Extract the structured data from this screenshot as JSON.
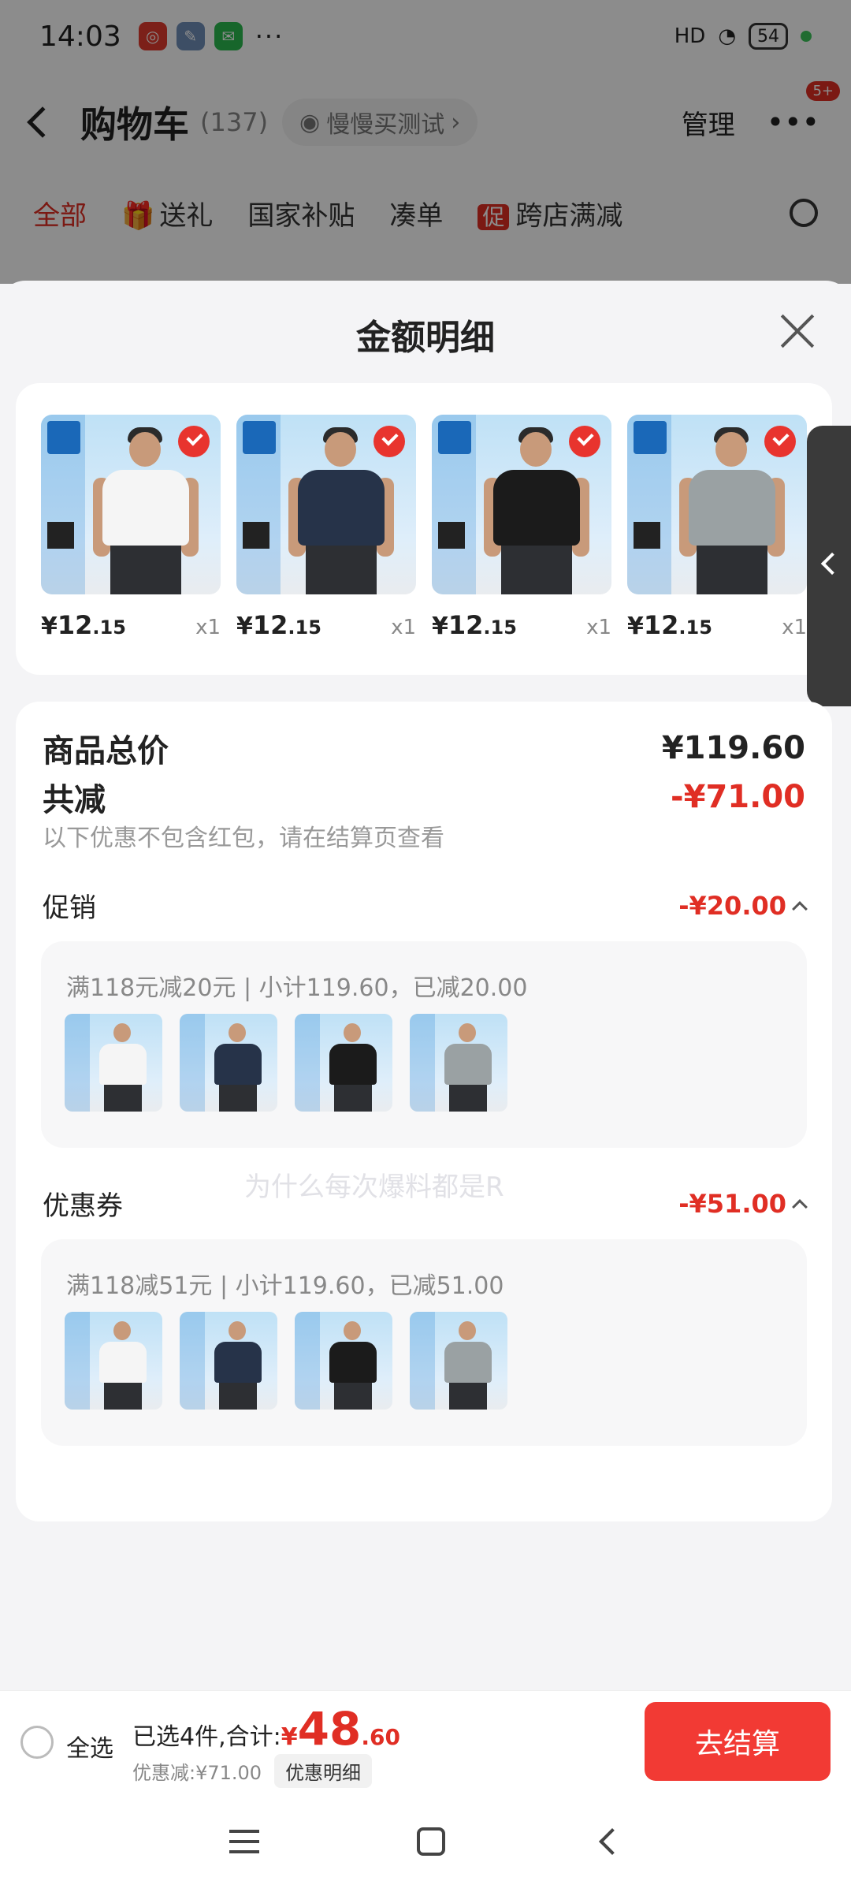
{
  "status_bar": {
    "time": "14:03",
    "more": "···",
    "signal": "HD",
    "battery": "54"
  },
  "cart_header": {
    "title": "购物车",
    "count": "(137)",
    "slow_buy": "慢慢买测试",
    "manage": "管理",
    "more_badge": "5+"
  },
  "cart_tabs": [
    "全部",
    "送礼",
    "国家补贴",
    "凑单",
    "跨店满减"
  ],
  "sheet": {
    "title": "金额明细"
  },
  "items": [
    {
      "shirt_color": "#f5f5f5",
      "yen": "¥",
      "price_int": "12",
      "price_dec": ".15",
      "qty": "x1"
    },
    {
      "shirt_color": "#263349",
      "yen": "¥",
      "price_int": "12",
      "price_dec": ".15",
      "qty": "x1"
    },
    {
      "shirt_color": "#1b1b1b",
      "yen": "¥",
      "price_int": "12",
      "price_dec": ".15",
      "qty": "x1"
    },
    {
      "shirt_color": "#9aa1a3",
      "yen": "¥",
      "price_int": "12",
      "price_dec": ".15",
      "qty": "x1"
    }
  ],
  "summary": {
    "total_label": "商品总价",
    "total_value": "¥119.60",
    "reduce_label": "共减",
    "reduce_value": "-¥71.00",
    "note": "以下优惠不包含红包，请在结算页查看",
    "watermark": "为什么每次爆料都是R",
    "promo": {
      "label": "促销",
      "value": "-¥20.00",
      "detail": "满118元减20元 | 小计119.60，已减20.00"
    },
    "coupon": {
      "label": "优惠券",
      "value": "-¥51.00",
      "detail": "满118减51元 | 小计119.60，已减51.00"
    }
  },
  "bottom_bar": {
    "select_all": "全选",
    "selected_label": "已选4件,合计:",
    "yen": "¥",
    "total_int": "48",
    "total_dec": ".60",
    "discount_text": "优惠减:¥71.00",
    "discount_detail": "优惠明细",
    "checkout": "去结算"
  },
  "colors": {
    "accent": "#e02e24",
    "checkout_bg": "#f23a34"
  }
}
